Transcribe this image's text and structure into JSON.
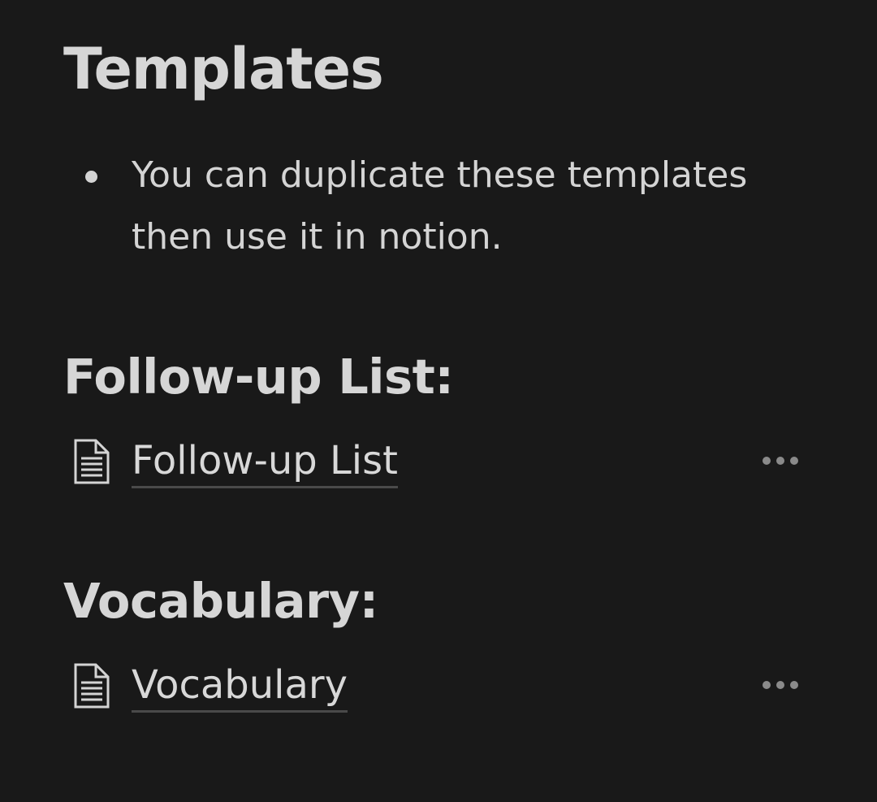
{
  "page": {
    "title": "Templates",
    "bullets": [
      "You can duplicate these templates then use it in notion."
    ]
  },
  "sections": [
    {
      "heading": "Follow-up List:",
      "link_label": "Follow-up List",
      "icon": "page-icon",
      "menu_icon": "more-icon"
    },
    {
      "heading": "Vocabulary:",
      "link_label": "Vocabulary",
      "icon": "page-icon",
      "menu_icon": "more-icon"
    }
  ],
  "colors": {
    "background": "#191919",
    "text": "#d4d4d4",
    "underline": "#4a4a4a",
    "muted_icon": "#8a8a8a"
  }
}
